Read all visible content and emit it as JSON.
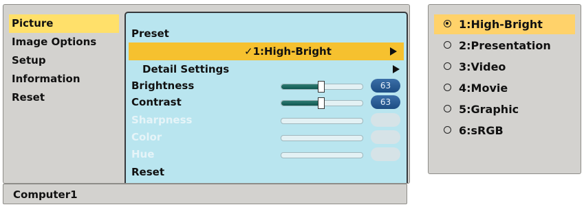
{
  "main_menu": {
    "items": [
      {
        "label": "Picture",
        "selected": true
      },
      {
        "label": "Image Options",
        "selected": false
      },
      {
        "label": "Setup",
        "selected": false
      },
      {
        "label": "Information",
        "selected": false
      },
      {
        "label": "Reset",
        "selected": false
      }
    ]
  },
  "picture_menu": {
    "preset_label": "Preset",
    "preset_value": "✓1:High-Bright",
    "detail_settings_label": "Detail Settings",
    "brightness": {
      "label": "Brightness",
      "value": "63",
      "level": 0.48
    },
    "contrast": {
      "label": "Contrast",
      "value": "63",
      "level": 0.48
    },
    "sharpness": {
      "label": "Sharpness",
      "enabled": false
    },
    "color": {
      "label": "Color",
      "enabled": false
    },
    "hue": {
      "label": "Hue",
      "enabled": false
    },
    "reset_label": "Reset"
  },
  "status_bar": {
    "source": "Computer1"
  },
  "preset_options": [
    {
      "label": "1:High-Bright",
      "selected": true
    },
    {
      "label": "2:Presentation",
      "selected": false
    },
    {
      "label": "3:Video",
      "selected": false
    },
    {
      "label": "4:Movie",
      "selected": false
    },
    {
      "label": "5:Graphic",
      "selected": false
    },
    {
      "label": "6:sRGB",
      "selected": false
    }
  ],
  "colors": {
    "menu_highlight": "#ffe06a",
    "row_highlight": "#f6c12f",
    "panel_bg": "#b9e5ef",
    "value_pill": "#2a5d96"
  },
  "icons": {
    "submenu_arrow": "triangle-right-icon",
    "radio_selected": "radio-on-icon",
    "radio_unselected": "radio-off-icon"
  }
}
